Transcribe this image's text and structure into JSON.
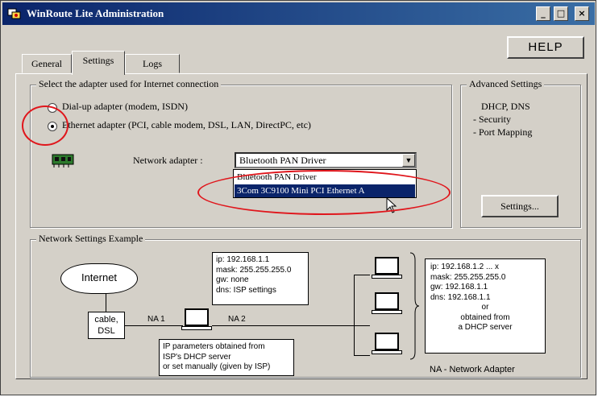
{
  "window": {
    "title": "WinRoute Lite Administration",
    "controls": {
      "minimize": "_",
      "maximize": "□",
      "close": "×"
    }
  },
  "help_button": "HELP",
  "tabs": [
    {
      "label": "General",
      "active": false
    },
    {
      "label": "Settings",
      "active": true
    },
    {
      "label": "Logs",
      "active": false
    }
  ],
  "adapter_group": {
    "legend": "Select the adapter used for Internet connection",
    "option_dialup": "Dial-up adapter (modem, ISDN)",
    "option_lan": "Ethernet adapter (PCI, cable modem, DSL, LAN, DirectPC, etc)",
    "selected": "lan",
    "network_adapter_label": "Network adapter :",
    "network_adapter_value": "Bluetooth PAN Driver",
    "dropdown_options": [
      "Bluetooth PAN Driver",
      "3Com 3C9100 Mini PCI Ethernet A"
    ],
    "dropdown_highlighted": 1
  },
  "advanced_group": {
    "legend": "Advanced Settings",
    "line1": "DHCP, DNS",
    "line2": "- Security",
    "line3": "- Port Mapping",
    "settings_button": "Settings..."
  },
  "example_group": {
    "legend": "Network Settings Example",
    "internet": "Internet",
    "cable_line1": "cable,",
    "cable_line2": "DSL",
    "na1": "NA 1",
    "na2": "NA 2",
    "na2_box": [
      "ip: 192.168.1.1",
      "mask: 255.255.255.0",
      "gw: none",
      "dns: ISP settings"
    ],
    "na1_box": [
      "IP parameters obtained from",
      "ISP's DHCP server",
      "or set manually (given by ISP)"
    ],
    "client_box": [
      "ip: 192.168.1.2 ... x",
      "mask: 255.255.255.0",
      "gw: 192.168.1.1",
      "dns: 192.168.1.1",
      "or",
      "obtained from",
      "a DHCP server"
    ],
    "footnote": "NA - Network Adapter"
  },
  "colors": {
    "annotation": "#e0161c",
    "selection": "#0a246a",
    "face": "#d4d0c8"
  }
}
